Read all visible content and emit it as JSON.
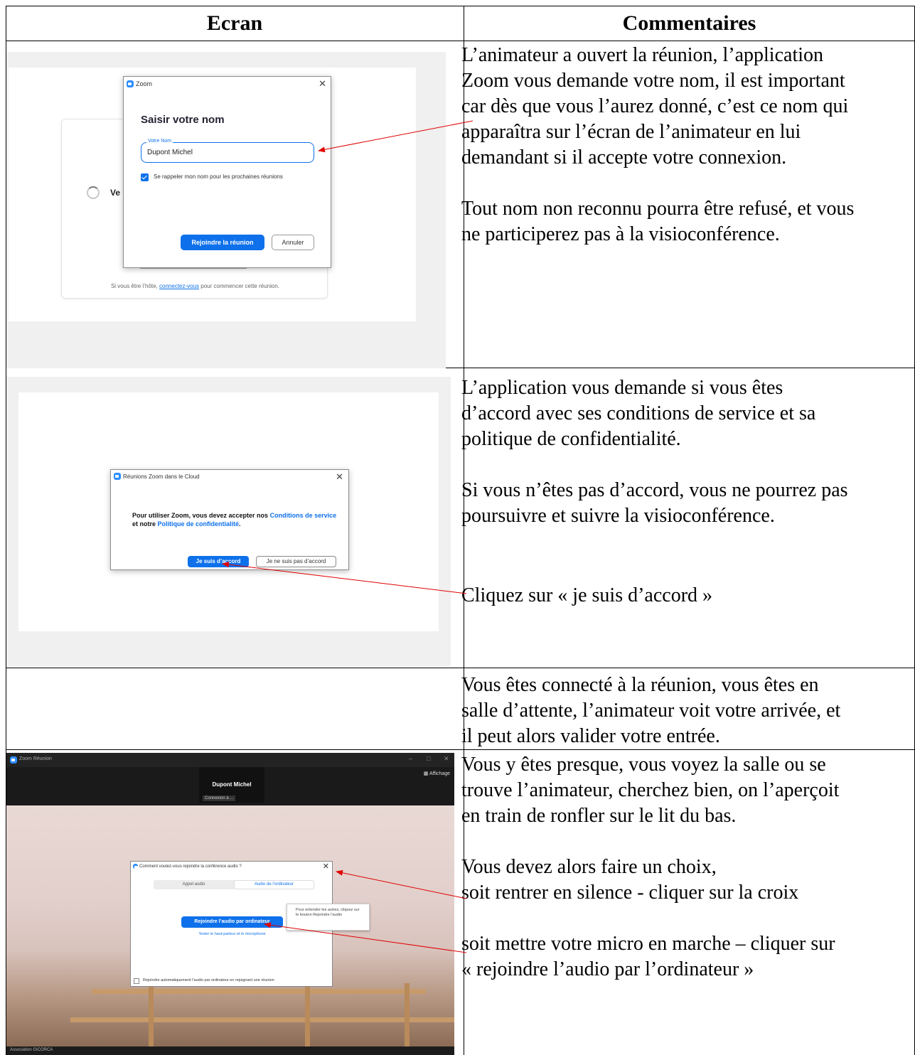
{
  "table": {
    "header_screen": "Ecran",
    "header_comments": "Commentaires"
  },
  "row1": {
    "comment": [
      "L’animateur a ouvert la réunion, l’application",
      "Zoom vous demande votre nom, il est important",
      "car dès que vous l’aurez donné, c’est ce nom qui",
      "apparaîtra sur l’écran de l’animateur en lui",
      "demandant si il accepte votre connexion.",
      "",
      "Tout nom non reconnu pourra être refusé, et vous",
      "ne participerez pas à la visioconférence."
    ],
    "screen": {
      "dialog_title": "Zoom",
      "heading": "Saisir votre nom",
      "field_label": "Votre Nom",
      "field_value": "Dupont Michel",
      "remember_label": "Se rappeler mon nom pour les prochaines réunions",
      "join_button": "Rejoindre la réunion",
      "cancel_button": "Annuler",
      "background_text": "Ve",
      "host_prefix": "Si vous être l’hôte,",
      "host_link": "connectez-vous",
      "host_suffix": "pour commencer cette réunion."
    }
  },
  "row2": {
    "comment": [
      "L’application vous demande si vous êtes",
      "d’accord avec ses conditions de service et sa",
      "politique de confidentialité.",
      "",
      "Si vous n’êtes pas d’accord, vous ne pourrez pas",
      "poursuivre et suivre la visioconférence."
    ],
    "comment_click": "Cliquez sur « je suis d’accord »",
    "screen": {
      "dialog_title": "Réunions Zoom dans le Cloud",
      "text_1": "Pour utiliser Zoom, vous devez accepter nos",
      "link_1": "Conditions de service",
      "text_2": "et notre",
      "link_2": "Politique de confidentialité",
      "text_3": ".",
      "agree_button": "Je suis d’accord",
      "disagree_button": "Je ne suis pas d’accord"
    }
  },
  "row3": {
    "comment": [
      "Vous êtes connecté à la réunion, vous êtes en",
      "salle d’attente, l’animateur voit votre arrivée, et",
      "il peut alors valider votre entrée."
    ]
  },
  "row4": {
    "comment": [
      "Vous y êtes presque, vous voyez la salle ou se",
      "trouve l’animateur, cherchez bien, on l’aperçoit",
      "en train de ronfler sur le lit du bas.",
      "",
      "Vous devez alors faire un choix,",
      "soit rentrer en silence - cliquer sur la croix",
      "",
      "soit mettre votre micro en marche – cliquer sur",
      "« rejoindre l’audio par l’ordinateur »"
    ],
    "screen": {
      "window_title": "Zoom Réunion",
      "view_label": "Affichage",
      "participant_name": "Dupont Michel",
      "connecting": "Connexion à ...",
      "dialog_title": "Comment voulez-vous rejoindre la conférence audio ?",
      "tab_phone": "Appel audio",
      "tab_computer": "Audio de l’ordinateur",
      "join_audio_button": "Rejoindre l’audio par ordinateur",
      "test_link": "Tester le haut-parleur et le microphone",
      "auto_join_label": "Rejoindre automatiquement l’audio par ordinateur en rejoignant une réunion",
      "tooltip": "Pour entendre les autres, cliquez sur le bouton Rejoindre l’audio",
      "bottom_label": "Association GICORCA"
    }
  },
  "colors": {
    "zoom_blue": "#0e71eb",
    "arrow_red": "#e00000"
  }
}
